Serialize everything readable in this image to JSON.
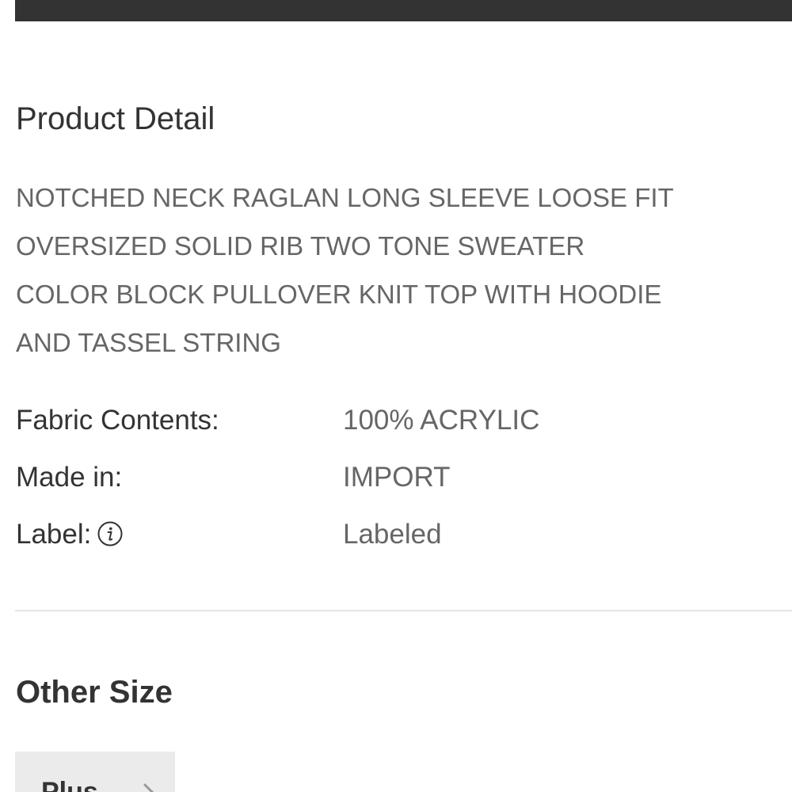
{
  "product_detail": {
    "title": "Product Detail",
    "description_lines": [
      "NOTCHED NECK RAGLAN LONG SLEEVE LOOSE FIT",
      "OVERSIZED SOLID RIB TWO TONE SWEATER",
      "COLOR BLOCK PULLOVER KNIT TOP WITH HOODIE",
      "AND TASSEL STRING"
    ],
    "specs": [
      {
        "label": "Fabric Contents:",
        "value": "100% ACRYLIC"
      },
      {
        "label": "Made in:",
        "value": "IMPORT"
      },
      {
        "label": "Label:",
        "value": "Labeled",
        "icon": "info-icon"
      }
    ]
  },
  "other_size": {
    "title": "Other Size",
    "options": [
      {
        "label": "Plus",
        "icon": "chevron-right-icon"
      }
    ]
  },
  "colors": {
    "top_bar": "#333333",
    "heading_text": "#333333",
    "body_text": "#666666",
    "divider": "#e3e3e3",
    "size_button_bg": "#ebebeb"
  }
}
